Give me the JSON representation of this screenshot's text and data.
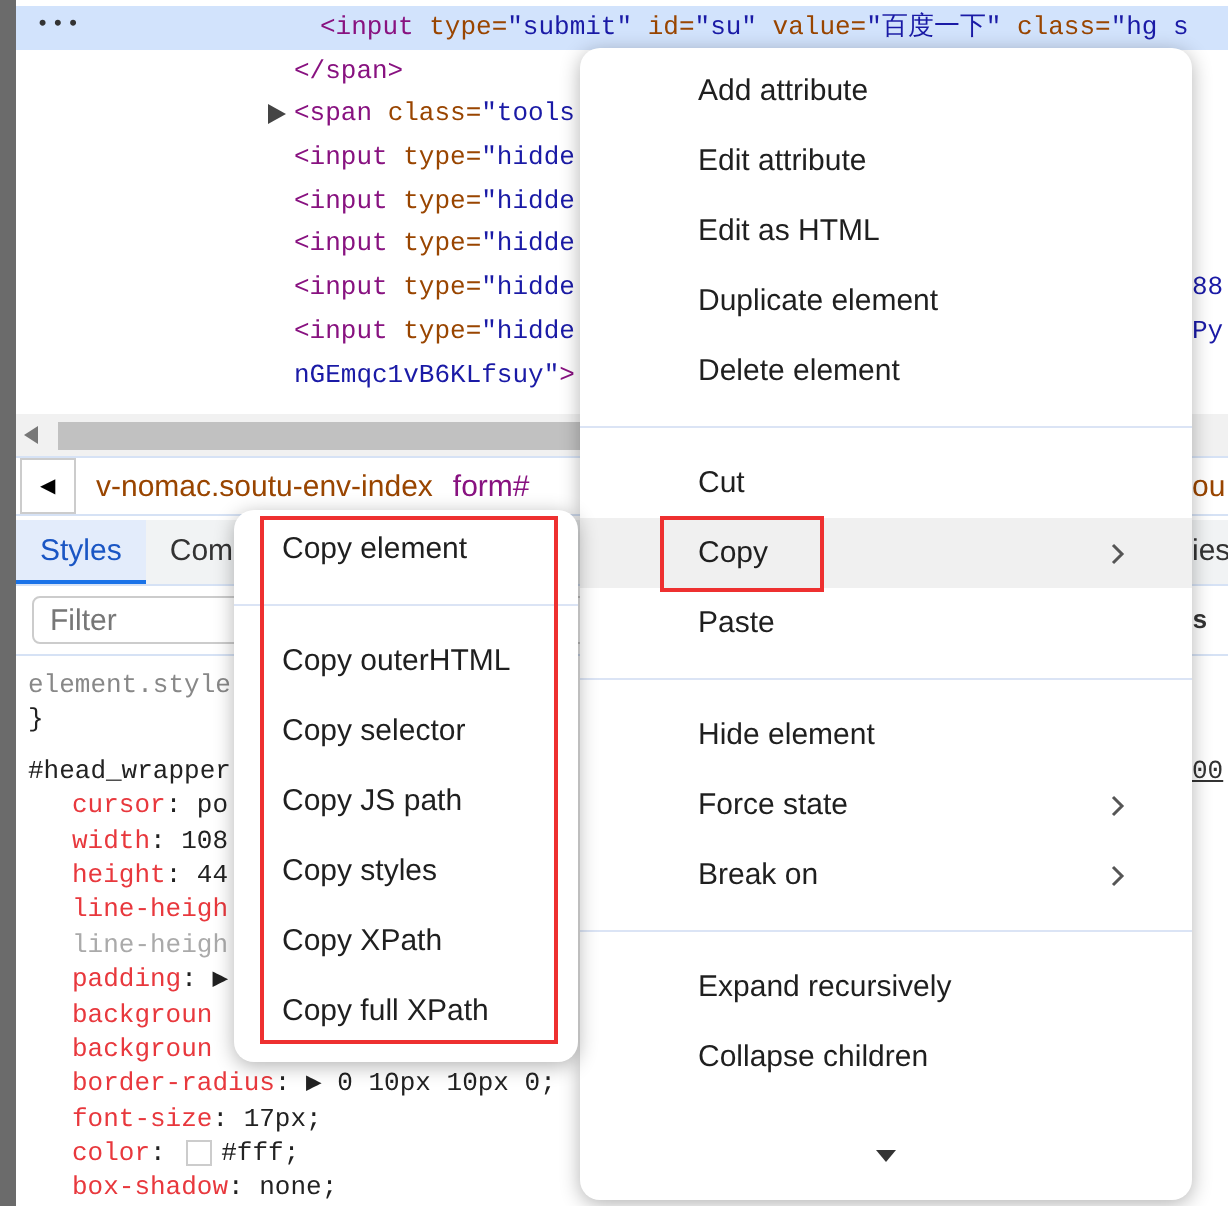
{
  "elements_tree": {
    "nodes": [
      {
        "children": [
          {
            "ellipsis": "•••",
            "selected": true,
            "tokens": [
              {
                "kind": "tag",
                "text": "<input"
              },
              {
                "kind": "attr",
                "text": " type="
              },
              {
                "kind": "value",
                "text": "\"submit\""
              },
              {
                "kind": "attr",
                "text": " id="
              },
              {
                "kind": "value",
                "text": "\"su\""
              },
              {
                "kind": "attr",
                "text": " value="
              },
              {
                "kind": "value",
                "text": "\"百度一下\""
              },
              {
                "kind": "attr",
                "text": " class="
              },
              {
                "kind": "value",
                "text": "\"hg s"
              }
            ]
          }
        ]
      },
      {
        "selected": false,
        "tokens": [
          {
            "kind": "tag",
            "text": "</span>"
          }
        ]
      },
      {
        "selected": false,
        "expandable": true,
        "tokens": [
          {
            "kind": "tag",
            "text": "<span"
          },
          {
            "kind": "attr",
            "text": " class="
          },
          {
            "kind": "value",
            "text": "\"tools"
          }
        ]
      },
      {
        "selected": false,
        "tokens": [
          {
            "kind": "tag",
            "text": "<input"
          },
          {
            "kind": "attr",
            "text": " type="
          },
          {
            "kind": "value",
            "text": "\"hidde"
          }
        ]
      },
      {
        "selected": false,
        "tokens": [
          {
            "kind": "tag",
            "text": "<input"
          },
          {
            "kind": "attr",
            "text": " type="
          },
          {
            "kind": "value",
            "text": "\"hidde"
          }
        ]
      },
      {
        "selected": false,
        "tokens": [
          {
            "kind": "tag",
            "text": "<input"
          },
          {
            "kind": "attr",
            "text": " type="
          },
          {
            "kind": "value",
            "text": "\"hidde"
          }
        ]
      },
      {
        "selected": false,
        "tail": "88",
        "tokens": [
          {
            "kind": "tag",
            "text": "<input"
          },
          {
            "kind": "attr",
            "text": " type="
          },
          {
            "kind": "value",
            "text": "\"hidde"
          }
        ]
      },
      {
        "selected": false,
        "tail": "Py",
        "tokens": [
          {
            "kind": "tag",
            "text": "<input"
          },
          {
            "kind": "attr",
            "text": " type="
          },
          {
            "kind": "value",
            "text": "\"hidde"
          }
        ]
      },
      {
        "selected": false,
        "tokens": [
          {
            "kind": "value",
            "text": "nGEmqc1vB6KLfsuy\""
          },
          {
            "kind": "tag",
            "text": ">"
          }
        ]
      }
    ]
  },
  "breadcrumbs": {
    "left_arrow": "◀",
    "items": [
      {
        "kind": "class",
        "text": "v-nomac.soutu-env-index"
      },
      {
        "kind": "tag",
        "text": "form#"
      }
    ],
    "tail": "ou"
  },
  "tabs": [
    {
      "label": "Styles",
      "selected": true
    },
    {
      "label": "Com",
      "selected": false
    }
  ],
  "tabs_tail": "ies",
  "filter": {
    "placeholder": "Filter",
    "tail": "s"
  },
  "styles": {
    "element_rule": "element.style",
    "close": "}",
    "selector": "#head_wrapper",
    "source": "00",
    "properties": [
      {
        "name": "cursor",
        "value": ": po",
        "inactive": false
      },
      {
        "name": "width",
        "value": ": 108",
        "inactive": false
      },
      {
        "name": "height",
        "value": ": 44",
        "inactive": false
      },
      {
        "name": "line-heigh",
        "inactive": false
      },
      {
        "name": "line-heigh",
        "inactive": true
      },
      {
        "name": "padding",
        "value": ": ▶",
        "inactive": false
      },
      {
        "name": "backgroun",
        "inactive": false
      },
      {
        "name": "backgroun",
        "inactive": false
      },
      {
        "name": "border-radius",
        "value": ": ▶ 0 10px 10px 0;",
        "inactive": false
      },
      {
        "name": "font-size",
        "value": ": 17px;",
        "inactive": false
      },
      {
        "name": "color",
        "value": ": ",
        "value_after_swatch": "#fff;",
        "color": "#ffffff",
        "inactive": false
      },
      {
        "name": "box-shadow",
        "value": ": none;",
        "inactive": false
      }
    ]
  },
  "context_menu": {
    "more_below": true,
    "groups": [
      [
        {
          "label": "Add attribute",
          "submenu": false,
          "selected": false,
          "annotated": false
        },
        {
          "label": "Edit attribute",
          "submenu": false,
          "selected": false,
          "annotated": false
        },
        {
          "label": "Edit as HTML",
          "submenu": false,
          "selected": false,
          "annotated": false
        },
        {
          "label": "Duplicate element",
          "submenu": false,
          "selected": false,
          "annotated": false
        },
        {
          "label": "Delete element",
          "submenu": false,
          "selected": false,
          "annotated": false
        }
      ],
      [
        {
          "label": "Cut",
          "submenu": false,
          "selected": false,
          "annotated": false
        },
        {
          "label": "Copy",
          "submenu": true,
          "selected": true,
          "annotated": true
        },
        {
          "label": "Paste",
          "submenu": false,
          "selected": false,
          "annotated": false
        }
      ],
      [
        {
          "label": "Hide element",
          "submenu": false,
          "selected": false,
          "annotated": false
        },
        {
          "label": "Force state",
          "submenu": true,
          "selected": false,
          "annotated": false
        },
        {
          "label": "Break on",
          "submenu": true,
          "selected": false,
          "annotated": false
        }
      ],
      [
        {
          "label": "Expand recursively",
          "submenu": false,
          "selected": false,
          "annotated": false
        },
        {
          "label": "Collapse children",
          "submenu": false,
          "selected": false,
          "annotated": false
        }
      ]
    ]
  },
  "copy_submenu": {
    "annotated": true,
    "groups": [
      [
        "Copy element"
      ],
      [
        "Copy outerHTML",
        "Copy selector",
        "Copy JS path",
        "Copy styles",
        "Copy XPath",
        "Copy full XPath"
      ]
    ]
  }
}
